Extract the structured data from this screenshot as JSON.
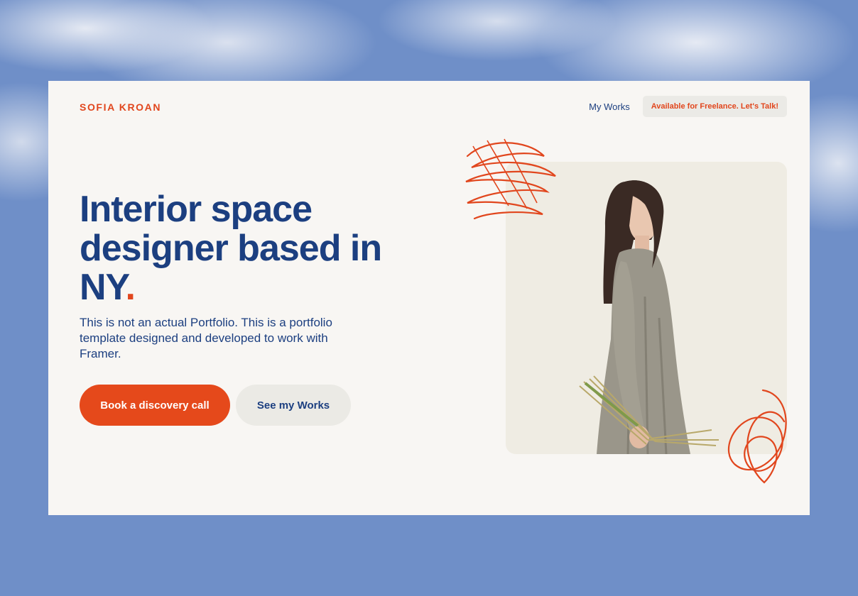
{
  "brand": {
    "name": "SOFIA KROAN"
  },
  "nav": {
    "works_link": "My Works",
    "cta": "Available for Freelance. Let's Talk!"
  },
  "hero": {
    "headline_line1": "Interior space",
    "headline_line2": "designer based in",
    "headline_line3": "NY",
    "headline_dot": ".",
    "description": "This is not an actual Portfolio. This is a portfolio template designed and developed to work with Framer.",
    "primary_button": "Book a discovery call",
    "secondary_button": "See my Works"
  },
  "colors": {
    "accent": "#e1461d",
    "primary_text": "#1c3f80",
    "card_bg": "#f8f6f3",
    "page_bg": "#6f8fc8"
  },
  "icons": {
    "top_scribble": "scribble-decoration-icon",
    "bottom_scribble": "scribble-decoration-icon"
  }
}
